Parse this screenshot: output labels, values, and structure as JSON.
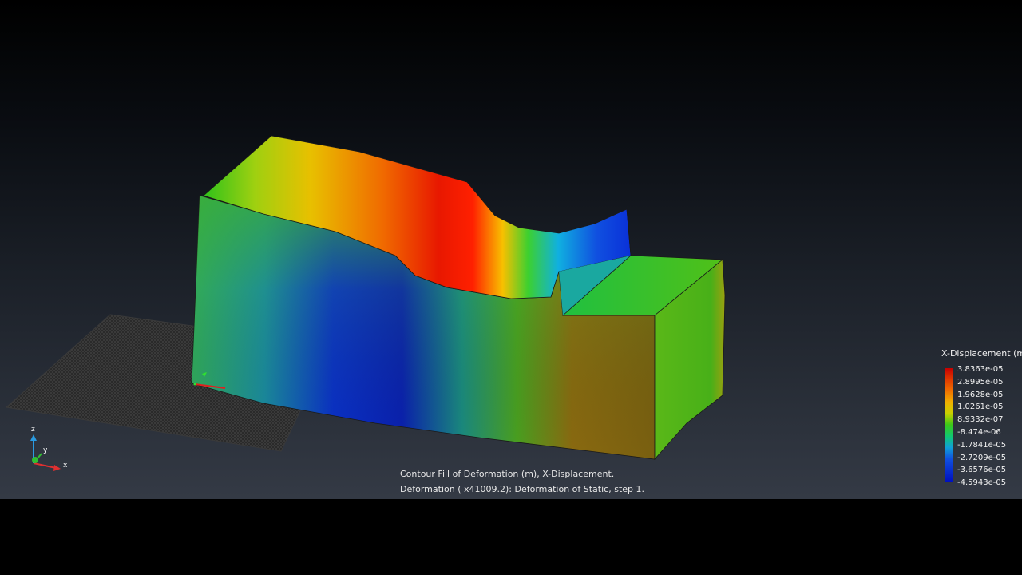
{
  "caption": {
    "line1": "Contour Fill of Deformation (m), X-Displacement.",
    "line2": "Deformation ( x41009.2): Deformation of Static, step 1."
  },
  "legend": {
    "title": "X-Displacement (m)",
    "values": [
      "3.8363e-05",
      "2.8995e-05",
      "1.9628e-05",
      "1.0261e-05",
      "8.9332e-07",
      "-8.474e-06",
      "-1.7841e-05",
      "-2.7209e-05",
      "-3.6576e-05",
      "-4.5943e-05"
    ]
  },
  "axes": {
    "z": "z",
    "y": "y",
    "x": "x"
  },
  "colors": {
    "background_top": "#000000",
    "background_bottom": "#343a45",
    "max_color": "#c80000",
    "min_color": "#0010c0"
  },
  "icons": {
    "triad": "axis-triad-icon"
  }
}
